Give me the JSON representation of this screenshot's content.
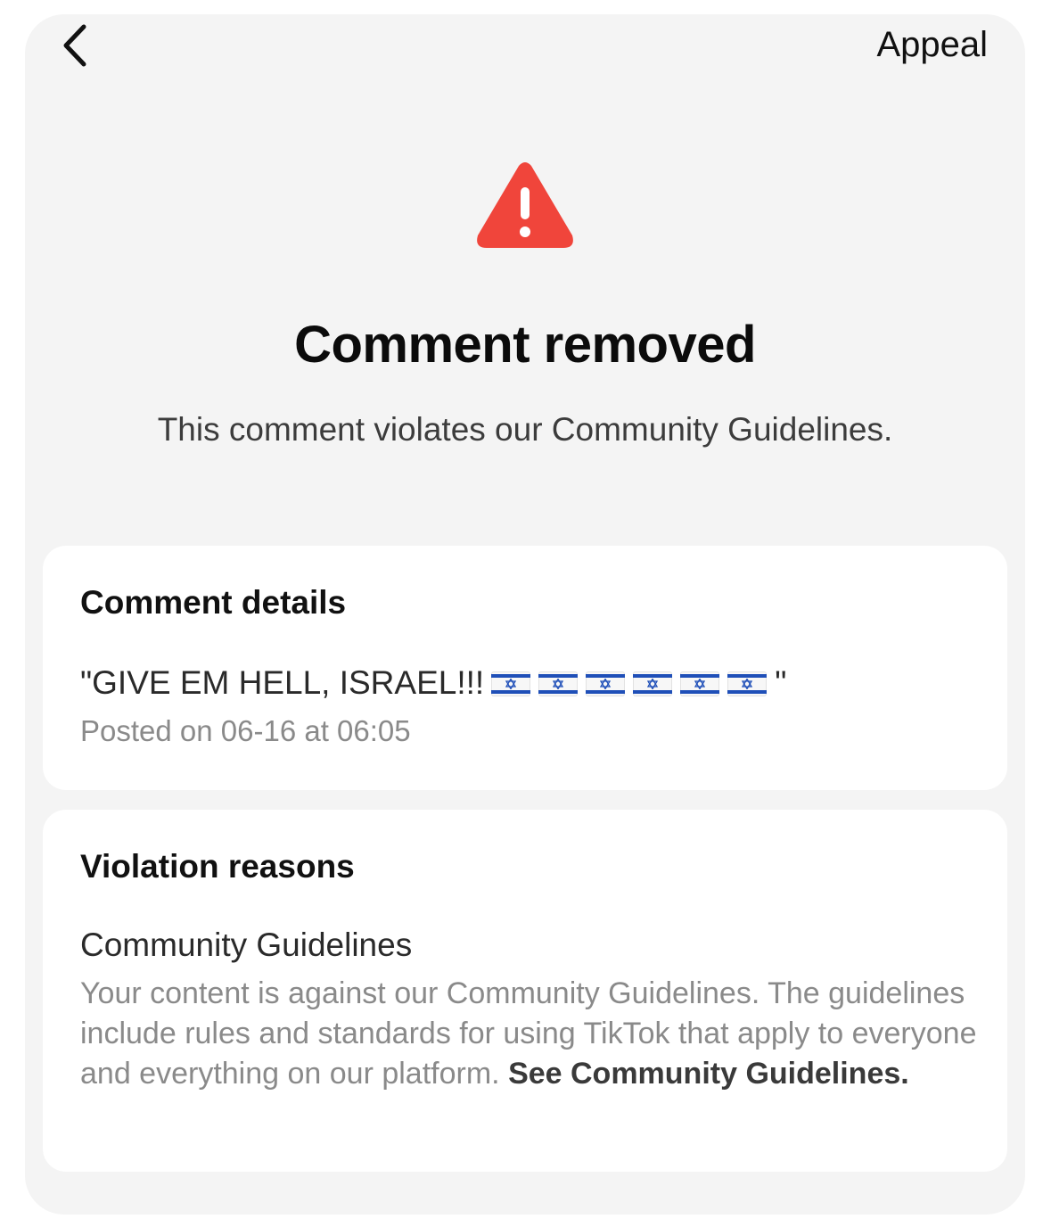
{
  "header": {
    "back_icon": "chevron-left-icon",
    "appeal_label": "Appeal"
  },
  "status": {
    "icon": "warning-triangle-icon",
    "icon_color": "#f0453b",
    "title": "Comment removed",
    "subtitle": "This comment violates our Community Guidelines."
  },
  "comment_details": {
    "heading": "Comment details",
    "quote_open": "\"GIVE EM HELL, ISRAEL!!!",
    "flags": [
      "israel-flag-icon",
      "israel-flag-icon",
      "israel-flag-icon",
      "israel-flag-icon",
      "israel-flag-icon",
      "israel-flag-icon"
    ],
    "quote_close": "\"",
    "posted_on": "Posted on 06-16 at 06:05"
  },
  "violation_reasons": {
    "heading": "Violation reasons",
    "reason_title": "Community Guidelines",
    "reason_body": "Your content is against our Community Guidelines. The guidelines include rules and standards for using TikTok that apply to everyone and everything on our platform.",
    "link_label": "See Community Guidelines."
  }
}
